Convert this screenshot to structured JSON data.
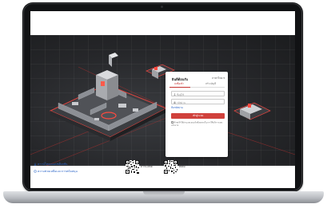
{
  "login": {
    "title": "ยินดีต้อนรับ",
    "language": "ภาษาไทย",
    "tabs": [
      {
        "label": "ลงชื่อเข้า"
      },
      {
        "label": "สร้างบัญชี"
      }
    ],
    "username_placeholder": "ชื่อผู้ใช้",
    "password_placeholder": "รหัสผ่าน",
    "forgot_password": "ลืมรหัสผ่าน",
    "login_button": "เข้าสู่ระบบ",
    "terms_text": "ข้าพเจ้าได้อ่านและยอมรับข้อตกลงในการใช้บริการและนโยบาย"
  },
  "footer": {
    "link_1": "ดาวน์โหลดแอปพลิเคชัน",
    "link_2": "ความช่วยเหลือและการสนับสนุน",
    "qr_1_label": "ดาวน์โหลด",
    "qr_2_label": "ติดต่อ"
  },
  "colors": {
    "accent": "#d0413c",
    "link": "#2a64c7",
    "hero_dark": "#26272a"
  },
  "icons": [
    "user-icon",
    "lock-icon",
    "download-icon",
    "support-icon",
    "qr-code-icon",
    "chevron-down-icon"
  ]
}
